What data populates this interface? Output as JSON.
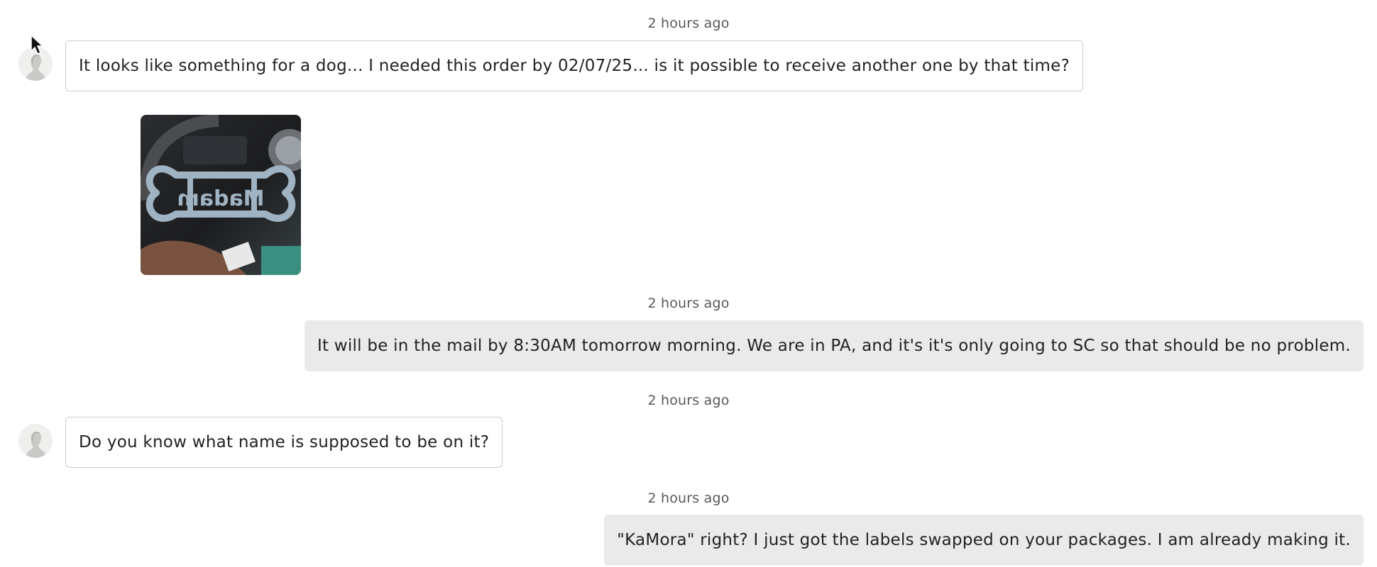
{
  "conversation": {
    "messages": [
      {
        "timestamp": "2 hours ago",
        "sender": "buyer",
        "text": "It looks like something for a dog... I needed this order by 02/07/25... is it possible to receive another one by that time?"
      },
      {
        "sender": "buyer",
        "attachment": {
          "type": "photo",
          "visible_text": "Madam"
        }
      },
      {
        "timestamp": "2 hours ago",
        "sender": "seller",
        "text": "It will be in the mail by 8:30AM tomorrow morning. We are in PA, and it's it's only going to SC so that should be no problem."
      },
      {
        "timestamp": "2 hours ago",
        "sender": "buyer",
        "text": "Do you know what name is supposed to be on it?"
      },
      {
        "timestamp": "2 hours ago",
        "sender": "seller",
        "text": "\"KaMora\" right? I just got the labels swapped on your packages. I am already making it."
      }
    ]
  },
  "icons": {
    "avatar": "user-avatar-icon",
    "cursor": "mouse-pointer-icon"
  },
  "colors": {
    "seller_bubble": "#eaeaea",
    "buyer_bubble_border": "#cfcfcf",
    "timestamp_text": "#595959",
    "message_text": "#222222"
  }
}
